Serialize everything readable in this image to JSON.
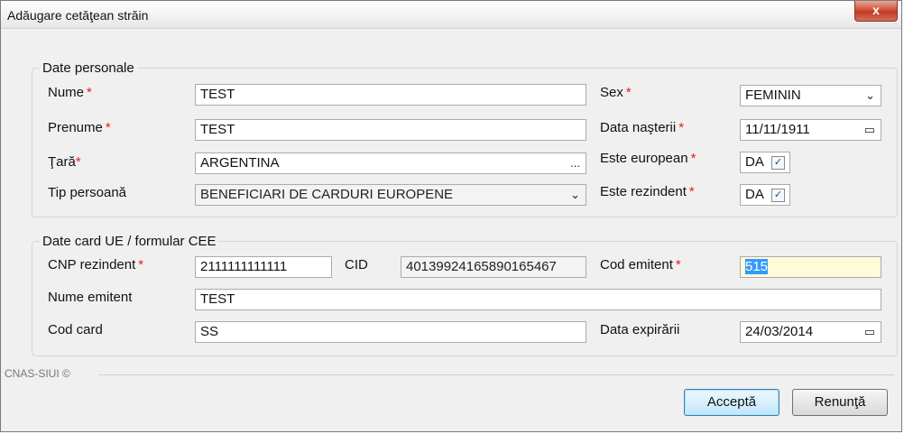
{
  "window": {
    "title": "Adăugare cetăţean străin",
    "close_label": "x"
  },
  "personal": {
    "legend": "Date personale",
    "nume": {
      "label": "Nume",
      "value": "TEST"
    },
    "prenume": {
      "label": "Prenume",
      "value": "TEST"
    },
    "tara": {
      "label": "Ţară",
      "value": "ARGENTINA",
      "button": "..."
    },
    "tip": {
      "label": "Tip persoană",
      "value": "BENEFICIARI DE CARDURI EUROPENE"
    },
    "sex": {
      "label": "Sex",
      "value": "FEMININ"
    },
    "data_nasterii": {
      "label": "Data naşterii",
      "value": "11/11/1911"
    },
    "european": {
      "label": "Este european",
      "value": "DA"
    },
    "rezident": {
      "label": "Este rezindent",
      "value": "DA"
    },
    "required_mark": "*"
  },
  "card": {
    "legend": "Date card UE / formular CEE",
    "cnp": {
      "label": "CNP rezindent",
      "value": "2111111111111"
    },
    "cid": {
      "label": "CID",
      "value": "40139924165890165467"
    },
    "cod_emitent": {
      "label": "Cod emitent",
      "value": "515"
    },
    "nume_emitent": {
      "label": "Nume emitent",
      "value": "TEST"
    },
    "cod_card": {
      "label": "Cod card",
      "value": "SS"
    },
    "data_expirarii": {
      "label": "Data expirării",
      "value": "24/03/2014"
    }
  },
  "footer": {
    "brand": "CNAS-SIUI ©",
    "accept": "Acceptă",
    "cancel": "Renunţă"
  },
  "glyphs": {
    "dropdown": "⌄",
    "date": "▭",
    "check": "✓"
  },
  "colors": {
    "required": "#e02020",
    "focused_field": "#fffbd8",
    "selection": "#3399ff"
  }
}
